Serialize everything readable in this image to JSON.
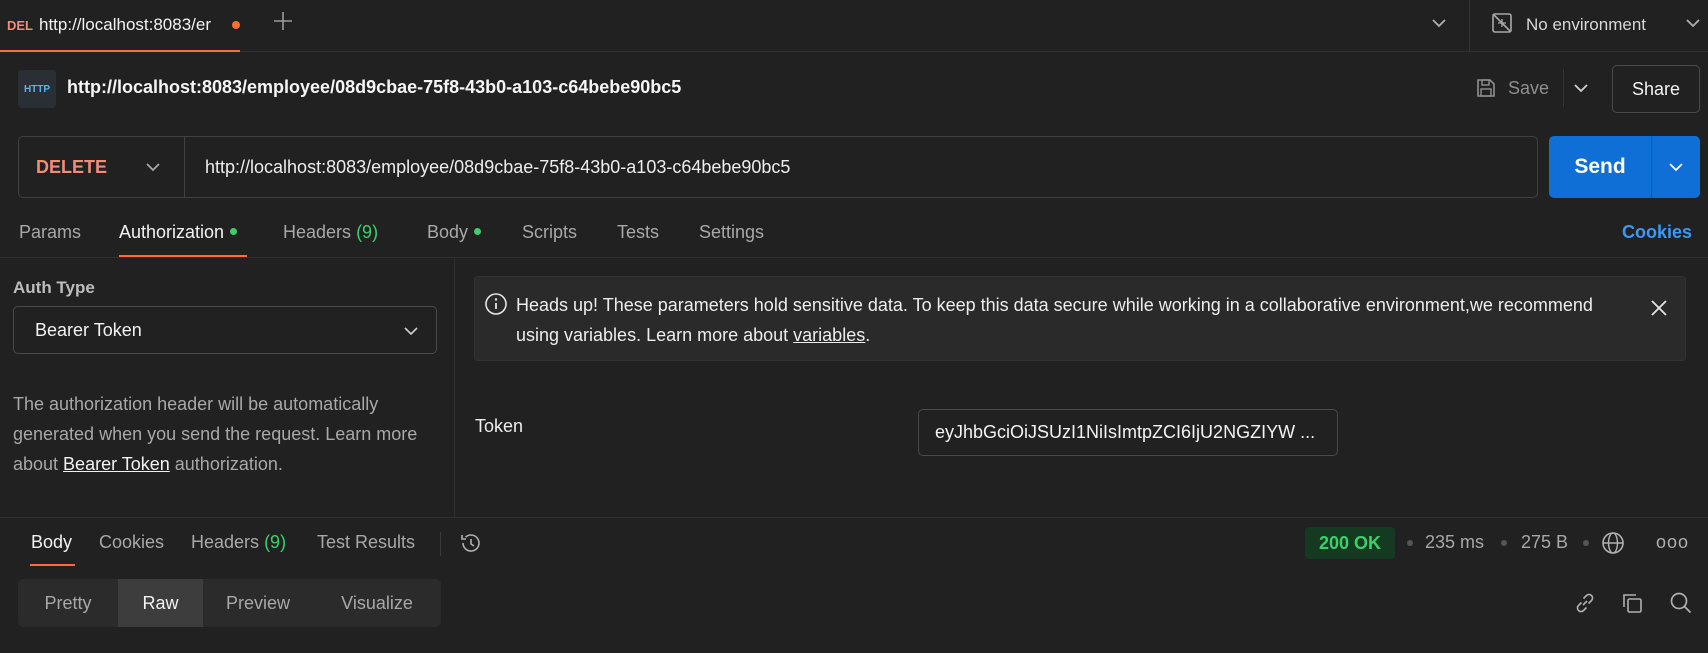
{
  "tabstrip": {
    "active_tab": {
      "method": "DEL",
      "title": "http://localhost:8083/er"
    },
    "environment": "No environment"
  },
  "request": {
    "title": "http://localhost:8083/employee/08d9cbae-75f8-43b0-a103-c64bebe90bc5",
    "http_icon_text": "HTTP",
    "save_label": "Save",
    "share_label": "Share",
    "method": "DELETE",
    "url": "http://localhost:8083/employee/08d9cbae-75f8-43b0-a103-c64bebe90bc5",
    "send_label": "Send"
  },
  "request_tabs": {
    "params": "Params",
    "authorization": "Authorization",
    "headers": "Headers",
    "headers_count": "(9)",
    "body": "Body",
    "scripts": "Scripts",
    "tests": "Tests",
    "settings": "Settings",
    "cookies": "Cookies"
  },
  "auth": {
    "type_label": "Auth Type",
    "type_value": "Bearer Token",
    "desc_prefix": "The authorization header will be automatically generated when you send the request. Learn more about ",
    "desc_link": "Bearer Token",
    "desc_suffix": " authorization.",
    "notice_prefix": "Heads up! These parameters hold sensitive data. To keep this data secure while working in a collaborative environment,we recommend using variables. Learn more about ",
    "notice_link": "variables",
    "notice_suffix": ".",
    "token_label": "Token",
    "token_value": "eyJhbGciOiJSUzI1NiIsImtpZCI6IjU2NGZIYW ..."
  },
  "response": {
    "tabs": {
      "body": "Body",
      "cookies": "Cookies",
      "headers": "Headers",
      "headers_count": "(9)",
      "test_results": "Test Results"
    },
    "status": "200 OK",
    "time": "235 ms",
    "size": "275 B",
    "more": "ooo",
    "format_tabs": [
      "Pretty",
      "Raw",
      "Preview",
      "Visualize"
    ],
    "active_format": "Raw"
  },
  "colors": {
    "accent": "#ff6c37",
    "method_delete": "#f08d78",
    "send": "#0f6fd6",
    "success": "#3ccf6a",
    "link": "#3b98f5"
  }
}
